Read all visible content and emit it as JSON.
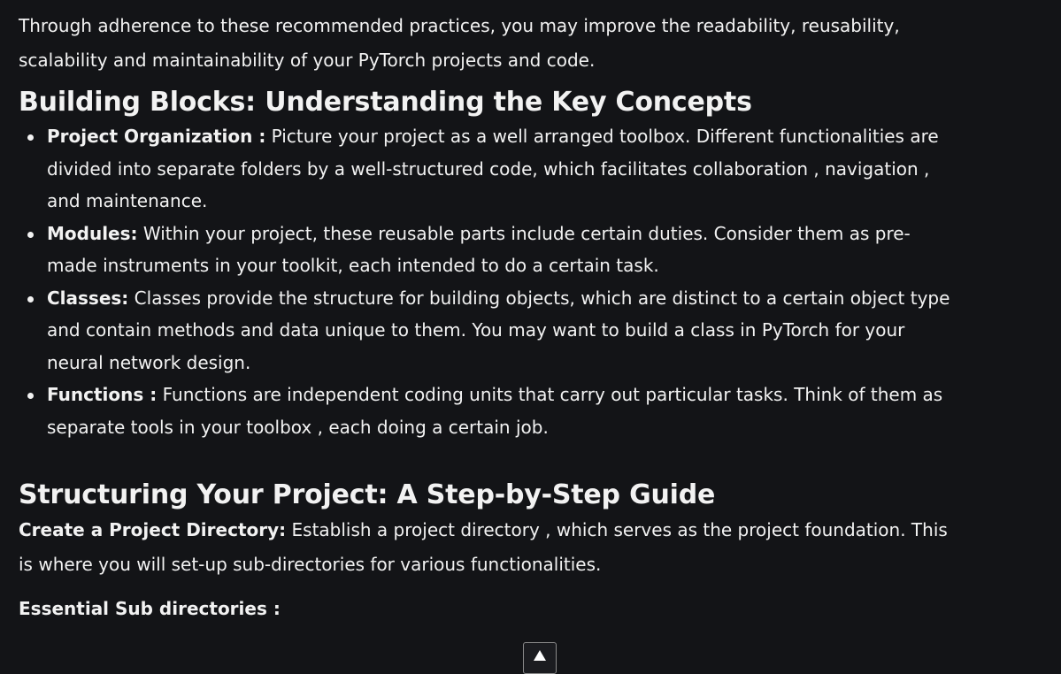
{
  "intro": {
    "text": "Through adherence to these recommended practices, you may improve the readability, reusability, scalability and maintainability of your PyTorch projects and code."
  },
  "building_blocks": {
    "heading": "Building Blocks: Understanding the Key Concepts",
    "items": [
      {
        "term": "Project Organization :",
        "text": " Picture your project as a well arranged toolbox. Different functionalities are divided into separate folders by a well-structured code, which facilitates collaboration , navigation , and maintenance."
      },
      {
        "term": "Modules:",
        "text": " Within your project, these reusable parts include certain duties. Consider them as pre-made instruments in your toolkit, each intended to do a certain task."
      },
      {
        "term": "Classes:",
        "text": " Classes provide the structure for building objects, which are distinct to a certain object type and contain methods and data unique to them. You may want to build a class in PyTorch for your neural network design."
      },
      {
        "term": "Functions :",
        "text": " Functions are independent coding units that carry out particular tasks. Think of them as separate tools in your toolbox , each doing a certain job."
      }
    ]
  },
  "structuring": {
    "heading": "Structuring Your Project: A Step-by-Step Guide",
    "step_term": "Create a Project Directory:",
    "step_text": " Establish a project directory , which serves as the project foundation. This is where you will set-up sub-directories for various functionalities.",
    "sub_heading": "Essential Sub directories :"
  },
  "scroll_top": {
    "icon": "arrow-up-icon"
  }
}
